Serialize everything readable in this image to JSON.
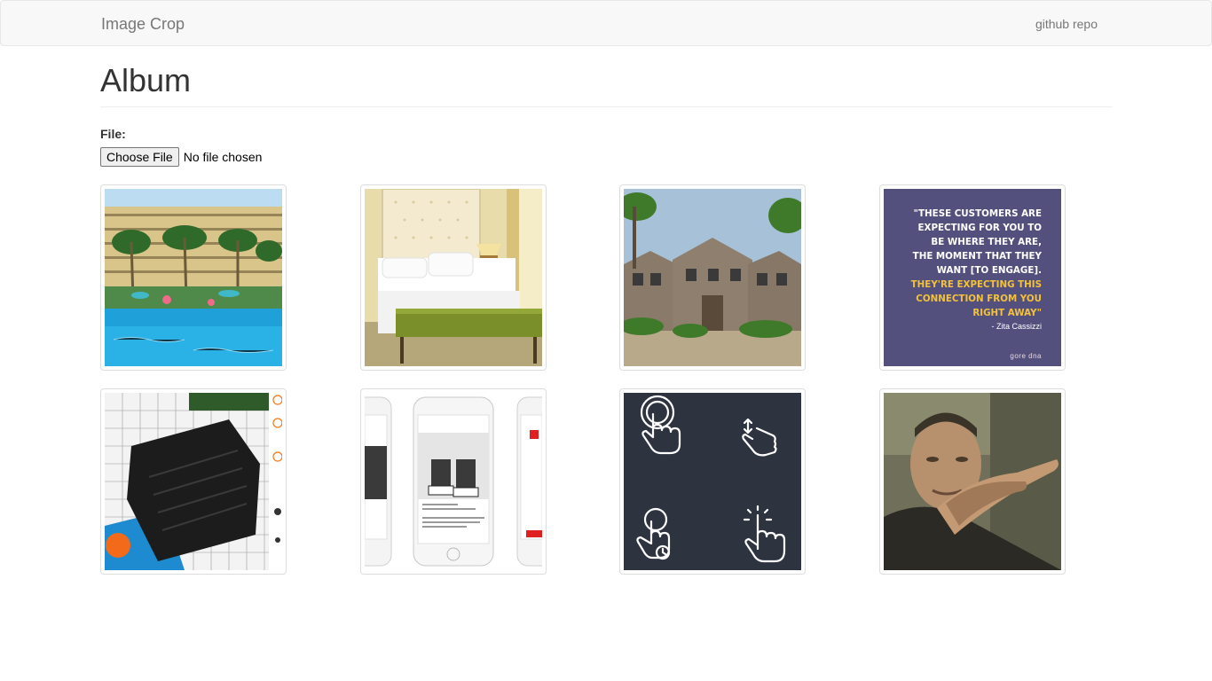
{
  "navbar": {
    "brand": "Image Crop",
    "link": "github repo"
  },
  "page": {
    "title": "Album"
  },
  "upload": {
    "label": "File:",
    "button": "Choose File",
    "status": "No file chosen"
  },
  "quote_card": {
    "line1": "\"These customers are expecting for you to be where they are, the moment that they want [to engage].",
    "line2": "They're expecting this connection from you right away\"",
    "author": "- Zita Cassizzi",
    "logo": "gore dna"
  },
  "album": {
    "images": [
      {
        "alt": "hotel-pool"
      },
      {
        "alt": "hotel-bedroom"
      },
      {
        "alt": "building-exterior"
      },
      {
        "alt": "quote-card"
      },
      {
        "alt": "isometric-bag"
      },
      {
        "alt": "phone-mockups"
      },
      {
        "alt": "gesture-icons"
      },
      {
        "alt": "pointing-man"
      }
    ]
  }
}
